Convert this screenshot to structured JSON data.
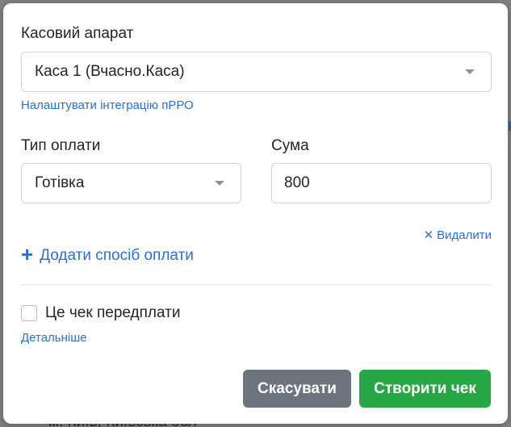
{
  "background": {
    "partial_text": "м. Київ, Київська обл"
  },
  "modal": {
    "cash_register": {
      "label": "Касовий апарат",
      "selected": "Каса 1 (Вчасно.Каса)",
      "setup_link": "Налаштувати інтеграцію пРРО"
    },
    "payment": {
      "type_label": "Тип оплати",
      "type_selected": "Готівка",
      "amount_label": "Сума",
      "amount_value": "800",
      "remove_label": "Видалити",
      "add_label": "Додати спосіб оплати"
    },
    "prepayment": {
      "label": "Це чек передплати",
      "checked": false,
      "details_link": "Детальніше"
    },
    "actions": {
      "cancel_label": "Скасувати",
      "create_label": "Створити чек"
    }
  },
  "colors": {
    "link": "#2d6fd0",
    "cancel_button": "#6c757d",
    "create_button": "#28a745"
  }
}
